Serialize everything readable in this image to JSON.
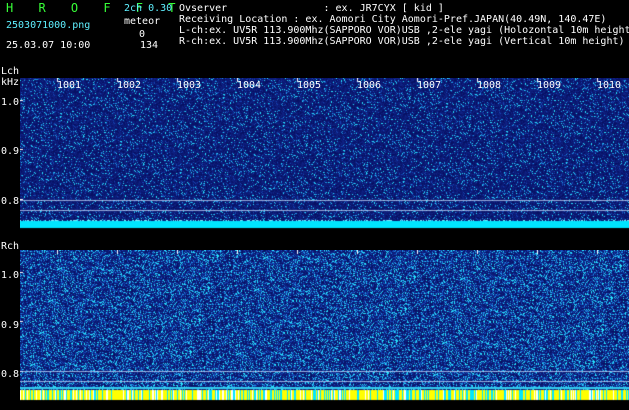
{
  "header": {
    "app_title": "H R O F F T",
    "mode": "2ch 0.30",
    "file_name": "2503071000.png",
    "meteor_label": "meteor",
    "meteor_count_l": "0",
    "timestamp": "25.03.07 10:00",
    "meteor_count_r": "134",
    "observer": "Ovserver                : ex. JR7CYX [ kid ]",
    "location": "Receiving Location : ex. Aomori City Aomori-Pref.JAPAN(40.49N, 140.47E)",
    "lch_info": "L-ch:ex. UV5R 113.900Mhz(SAPPORO VOR)USB ,2-ele yagi (Holozontal 10m height)",
    "rch_info": "R-ch:ex. UV5R 113.900Mhz(SAPPORO VOR)USB ,2-ele yagi (Vertical 10m height)"
  },
  "lch": {
    "label": "Lch",
    "unit": "kHz",
    "y_ticks": [
      "1.0",
      "0.9",
      "0.8"
    ]
  },
  "rch": {
    "label": "Rch",
    "y_ticks": [
      "1.0",
      "0.9",
      "0.8"
    ]
  },
  "time_ticks": [
    "1001",
    "1002",
    "1003",
    "1004",
    "1005",
    "1006",
    "1007",
    "1008",
    "1009",
    "1010"
  ],
  "colors": {
    "background": "#000000",
    "header_cyan": "#5ff0ff",
    "title_green": "#37ff37",
    "spectrum_base": "#0a1a7a",
    "baseline_cyan": "#00e5ff",
    "baseline_yellow": "#ffff00"
  }
}
